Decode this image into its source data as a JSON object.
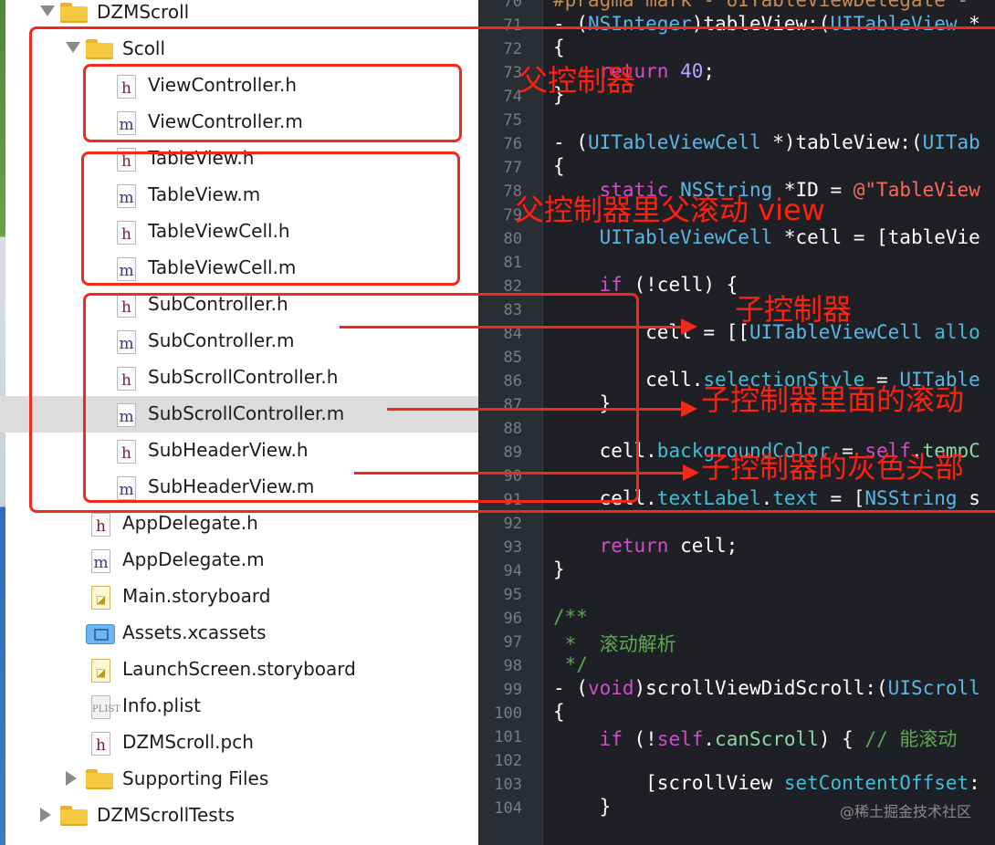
{
  "navigator": {
    "rows": [
      {
        "label": "DZMScroll",
        "icon": "folder-icon",
        "disclosure": "open"
      },
      {
        "label": "Scoll",
        "icon": "folder-icon",
        "disclosure": "open"
      },
      {
        "label": "ViewController.h",
        "icon": "header-file-icon",
        "icon_letter": "h"
      },
      {
        "label": "ViewController.m",
        "icon": "implementation-file-icon",
        "icon_letter": "m"
      },
      {
        "label": "TableView.h",
        "icon": "header-file-icon",
        "icon_letter": "h"
      },
      {
        "label": "TableView.m",
        "icon": "implementation-file-icon",
        "icon_letter": "m"
      },
      {
        "label": "TableViewCell.h",
        "icon": "header-file-icon",
        "icon_letter": "h"
      },
      {
        "label": "TableViewCell.m",
        "icon": "implementation-file-icon",
        "icon_letter": "m"
      },
      {
        "label": "SubController.h",
        "icon": "header-file-icon",
        "icon_letter": "h"
      },
      {
        "label": "SubController.m",
        "icon": "implementation-file-icon",
        "icon_letter": "m"
      },
      {
        "label": "SubScrollController.h",
        "icon": "header-file-icon",
        "icon_letter": "h"
      },
      {
        "label": "SubScrollController.m",
        "icon": "implementation-file-icon",
        "icon_letter": "m",
        "selected": true
      },
      {
        "label": "SubHeaderView.h",
        "icon": "header-file-icon",
        "icon_letter": "h"
      },
      {
        "label": "SubHeaderView.m",
        "icon": "implementation-file-icon",
        "icon_letter": "m"
      },
      {
        "label": "AppDelegate.h",
        "icon": "header-file-icon",
        "icon_letter": "h"
      },
      {
        "label": "AppDelegate.m",
        "icon": "implementation-file-icon",
        "icon_letter": "m"
      },
      {
        "label": "Main.storyboard",
        "icon": "storyboard-file-icon"
      },
      {
        "label": "Assets.xcassets",
        "icon": "asset-catalog-icon"
      },
      {
        "label": "LaunchScreen.storyboard",
        "icon": "storyboard-file-icon"
      },
      {
        "label": "Info.plist",
        "icon": "plist-file-icon",
        "icon_letter": "PLIST"
      },
      {
        "label": "DZMScroll.pch",
        "icon": "header-file-icon",
        "icon_letter": "h"
      },
      {
        "label": "Supporting Files",
        "icon": "folder-icon",
        "disclosure": "closed"
      },
      {
        "label": "DZMScrollTests",
        "icon": "folder-icon",
        "disclosure": "closed"
      }
    ]
  },
  "editor": {
    "line_numbers": [
      "70",
      "71",
      "72",
      "73",
      "74",
      "75",
      "76",
      "77",
      "78",
      "79",
      "80",
      "81",
      "82",
      "83",
      "84",
      "85",
      "86",
      "87",
      "88",
      "89",
      "90",
      "91",
      "92",
      "93",
      "94",
      "95",
      "96",
      "97",
      "98",
      "99",
      "100",
      "101",
      "102",
      "103",
      "104"
    ],
    "lines": [
      [
        {
          "t": "#pragma mark - UITableViewDelegate -",
          "c": "pp"
        }
      ],
      [
        {
          "t": "- (",
          "c": ""
        },
        {
          "t": "NSInteger",
          "c": "ty"
        },
        {
          "t": ")tableView:(",
          "c": ""
        },
        {
          "t": "UITableView",
          "c": "ty"
        },
        {
          "t": " *",
          "c": ""
        }
      ],
      [
        {
          "t": "{",
          "c": ""
        }
      ],
      [
        {
          "t": "    ",
          "c": ""
        },
        {
          "t": "return",
          "c": "kw"
        },
        {
          "t": " ",
          "c": ""
        },
        {
          "t": "40",
          "c": "nu"
        },
        {
          "t": ";",
          "c": ""
        }
      ],
      [
        {
          "t": "}",
          "c": ""
        }
      ],
      [],
      [
        {
          "t": "- (",
          "c": ""
        },
        {
          "t": "UITableViewCell",
          "c": "ty"
        },
        {
          "t": " *)tableView:(",
          "c": ""
        },
        {
          "t": "UITab",
          "c": "ty"
        }
      ],
      [
        {
          "t": "{",
          "c": ""
        }
      ],
      [
        {
          "t": "    ",
          "c": ""
        },
        {
          "t": "static",
          "c": "kw"
        },
        {
          "t": " ",
          "c": ""
        },
        {
          "t": "NSString",
          "c": "ty"
        },
        {
          "t": " *ID = ",
          "c": ""
        },
        {
          "t": "@\"TableView",
          "c": "st"
        }
      ],
      [],
      [
        {
          "t": "    ",
          "c": ""
        },
        {
          "t": "UITableViewCell",
          "c": "ty"
        },
        {
          "t": " *cell = [tableVie",
          "c": ""
        }
      ],
      [],
      [
        {
          "t": "    ",
          "c": ""
        },
        {
          "t": "if",
          "c": "kw"
        },
        {
          "t": " (!cell) {",
          "c": ""
        }
      ],
      [],
      [
        {
          "t": "        cell = [[",
          "c": ""
        },
        {
          "t": "UITableViewCell",
          "c": "ty"
        },
        {
          "t": " ",
          "c": ""
        },
        {
          "t": "allo",
          "c": "pr"
        }
      ],
      [],
      [
        {
          "t": "        cell.",
          "c": ""
        },
        {
          "t": "selectionStyle",
          "c": "pr"
        },
        {
          "t": " = ",
          "c": ""
        },
        {
          "t": "UITable",
          "c": "ty"
        }
      ],
      [
        {
          "t": "    }",
          "c": ""
        }
      ],
      [],
      [
        {
          "t": "    cell.",
          "c": ""
        },
        {
          "t": "backgroundColor",
          "c": "pr"
        },
        {
          "t": " = ",
          "c": ""
        },
        {
          "t": "self",
          "c": "kw"
        },
        {
          "t": ".",
          "c": ""
        },
        {
          "t": "tempC",
          "c": "fn"
        }
      ],
      [],
      [
        {
          "t": "    cell.",
          "c": ""
        },
        {
          "t": "textLabel",
          "c": "pr"
        },
        {
          "t": ".",
          "c": ""
        },
        {
          "t": "text",
          "c": "pr"
        },
        {
          "t": " = [",
          "c": ""
        },
        {
          "t": "NSString",
          "c": "ty"
        },
        {
          "t": " s",
          "c": ""
        }
      ],
      [],
      [
        {
          "t": "    ",
          "c": ""
        },
        {
          "t": "return",
          "c": "kw"
        },
        {
          "t": " cell;",
          "c": ""
        }
      ],
      [
        {
          "t": "}",
          "c": ""
        }
      ],
      [],
      [
        {
          "t": "/**",
          "c": "cm"
        }
      ],
      [
        {
          "t": " *  滚动解析",
          "c": "cm"
        }
      ],
      [
        {
          "t": " */",
          "c": "cm"
        }
      ],
      [
        {
          "t": "- (",
          "c": ""
        },
        {
          "t": "void",
          "c": "kw"
        },
        {
          "t": ")scrollViewDidScroll:(",
          "c": ""
        },
        {
          "t": "UIScroll",
          "c": "ty"
        }
      ],
      [
        {
          "t": "{",
          "c": ""
        }
      ],
      [
        {
          "t": "    ",
          "c": ""
        },
        {
          "t": "if",
          "c": "kw"
        },
        {
          "t": " (!",
          "c": ""
        },
        {
          "t": "self",
          "c": "kw"
        },
        {
          "t": ".",
          "c": ""
        },
        {
          "t": "canScroll",
          "c": "fn"
        },
        {
          "t": ") { ",
          "c": ""
        },
        {
          "t": "// 能滚动",
          "c": "cm"
        }
      ],
      [],
      [
        {
          "t": "        [scrollView ",
          "c": ""
        },
        {
          "t": "setContentOffset",
          "c": "pr"
        },
        {
          "t": ":",
          "c": ""
        }
      ],
      [
        {
          "t": "    }",
          "c": ""
        }
      ]
    ],
    "watermark": "@稀土掘金技术社区"
  },
  "annotations": {
    "parent_controller": "父控制器",
    "parent_scroll_view": "父控制器里父滚动 view",
    "sub_controller": "子控制器",
    "sub_scroll_view": "子控制器里面的滚动",
    "sub_header_view": "子控制器的灰色头部"
  },
  "colors": {
    "annotation_red": "#f2291c",
    "selection_gray": "#dcdcdc",
    "editor_background": "#1e2026"
  }
}
